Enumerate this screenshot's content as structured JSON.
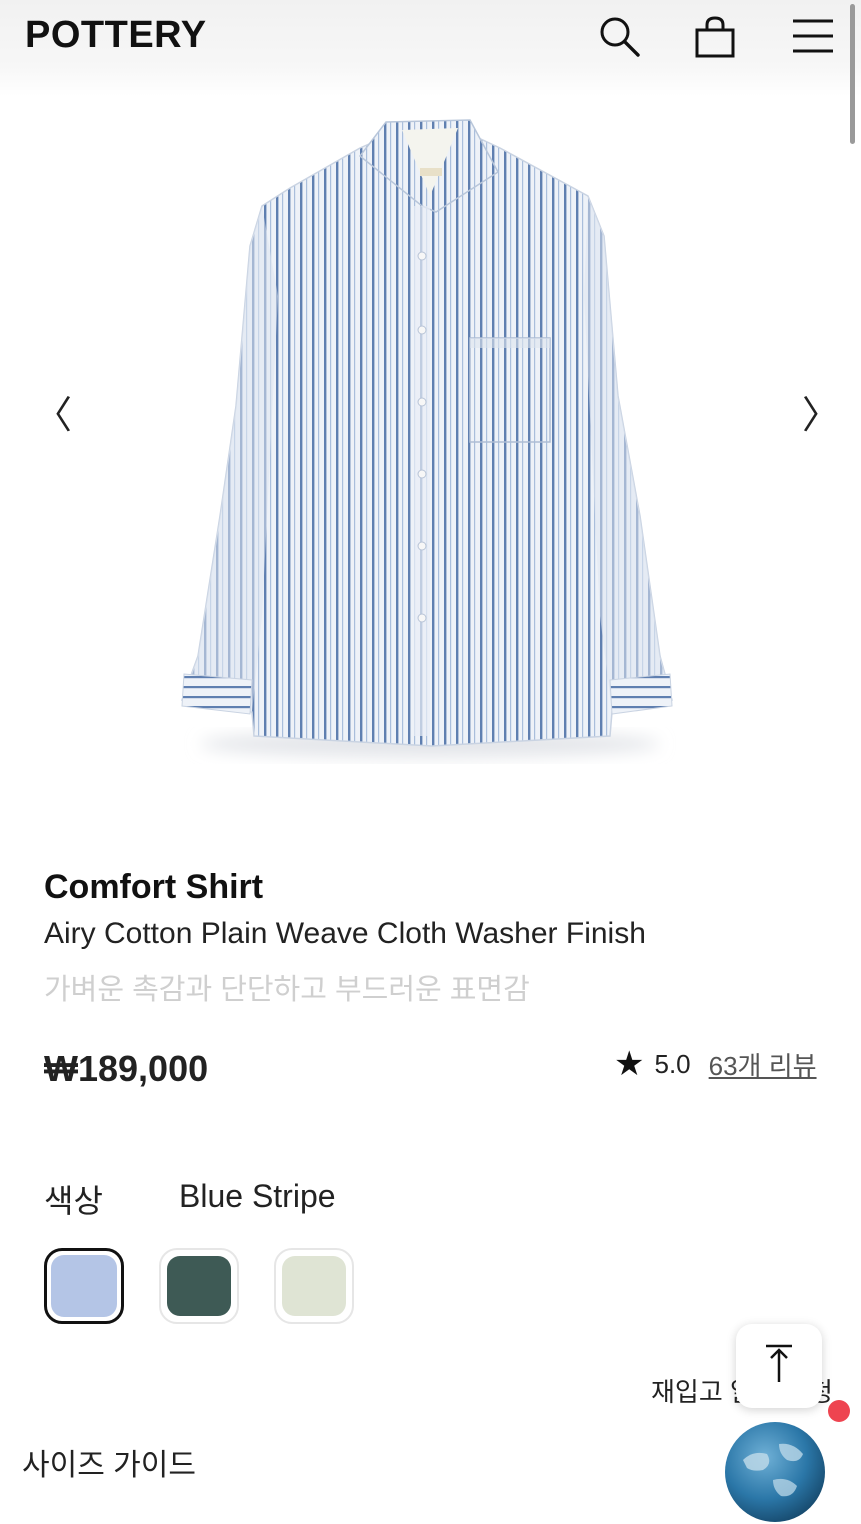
{
  "header": {
    "logo": "POTTERY",
    "icons": [
      "search-icon",
      "shopping-bag-icon",
      "menu-icon"
    ]
  },
  "product": {
    "name": "Comfort Shirt",
    "subtitle": "Airy Cotton Plain Weave Cloth Washer Finish",
    "description_ko": "가벼운 촉감과 단단하고 부드러운 표면감",
    "price": "₩189,000",
    "rating": "5.0",
    "reviews_link": "63개 리뷰"
  },
  "carousel": {
    "prev_arrow": "〈",
    "next_arrow": "〉"
  },
  "color": {
    "label": "색상",
    "selected": "Blue Stripe",
    "swatches": [
      "#b4c5e6",
      "#3e5a55",
      "#dfe4d4"
    ]
  },
  "restock": {
    "label": "재입고 알림 신청"
  },
  "size_guide": {
    "label": "사이즈 가이드"
  },
  "colors": {
    "text": "#111111",
    "muted": "#cfcfcf",
    "notification": "#ee4450"
  }
}
